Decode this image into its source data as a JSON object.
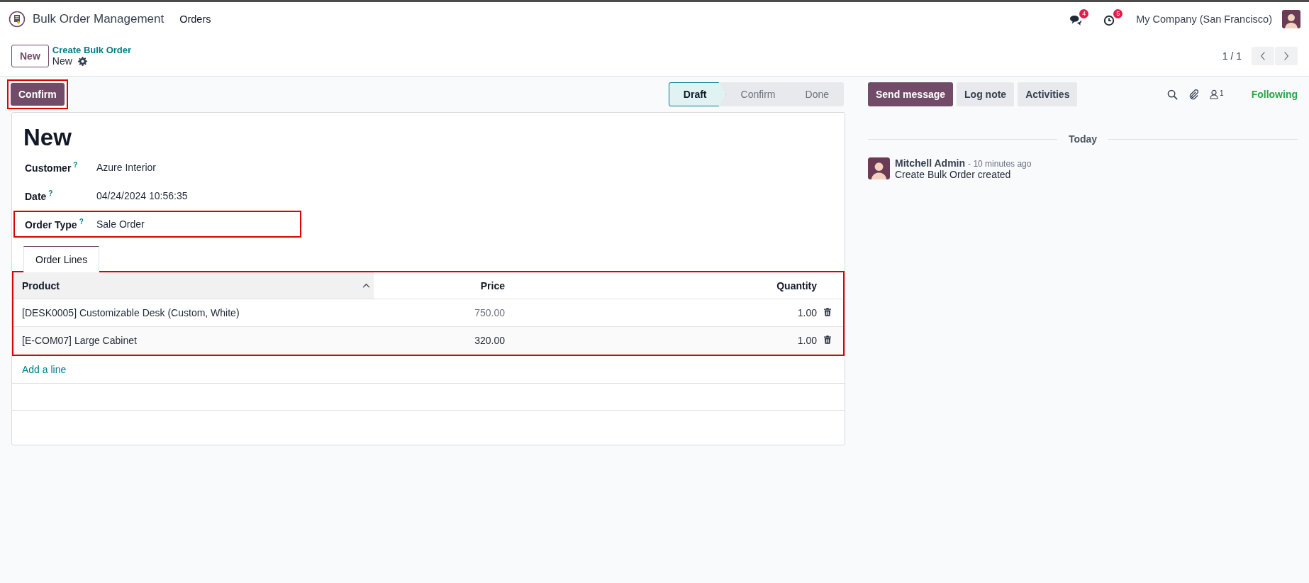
{
  "navbar": {
    "app_name": "Bulk Order Management",
    "menus": [
      "Orders"
    ],
    "messages_badge": "4",
    "activities_badge": "5",
    "company": "My Company (San Francisco)"
  },
  "control_panel": {
    "new_button": "New",
    "breadcrumb": "Create Bulk Order",
    "record": "New",
    "pager": "1 / 1"
  },
  "statusbar": {
    "confirm_button": {
      "label": "Confirm",
      "highlighted": true
    },
    "stages": [
      {
        "label": "Draft",
        "selected": true
      },
      {
        "label": "Confirm",
        "selected": false
      },
      {
        "label": "Done",
        "selected": false
      }
    ]
  },
  "form": {
    "title": "New",
    "fields": [
      {
        "label": "Customer",
        "help": "?",
        "value": "Azure Interior",
        "highlighted": false
      },
      {
        "label": "Date",
        "help": "?",
        "value": "04/24/2024 10:56:35",
        "highlighted": false
      },
      {
        "label": "Order Type",
        "help": "?",
        "value": "Sale Order",
        "highlighted": true
      }
    ],
    "tabs": [
      {
        "label": "Order Lines",
        "selected": true
      }
    ],
    "table": {
      "highlighted": true,
      "columns": [
        "Product",
        "Price",
        "Quantity"
      ],
      "rows": [
        {
          "cells": [
            "[DESK0005] Customizable Desk (Custom, White)",
            "750.00",
            "1.00"
          ],
          "selected": true
        },
        {
          "cells": [
            "[E-COM07] Large Cabinet",
            "320.00",
            "1.00"
          ],
          "selected": false
        }
      ],
      "add_line": "Add a line"
    }
  },
  "chatter": {
    "buttons": [
      {
        "label": "Send message",
        "kind": "primary"
      },
      {
        "label": "Log note",
        "kind": "secondary"
      },
      {
        "label": "Activities",
        "kind": "secondary"
      }
    ],
    "followers_count": "1",
    "follow_state": "Following",
    "date_separator": "Today",
    "messages": [
      {
        "author": "Mitchell Admin",
        "time": "- 10 minutes ago",
        "body": "Create Bulk Order created"
      }
    ]
  }
}
